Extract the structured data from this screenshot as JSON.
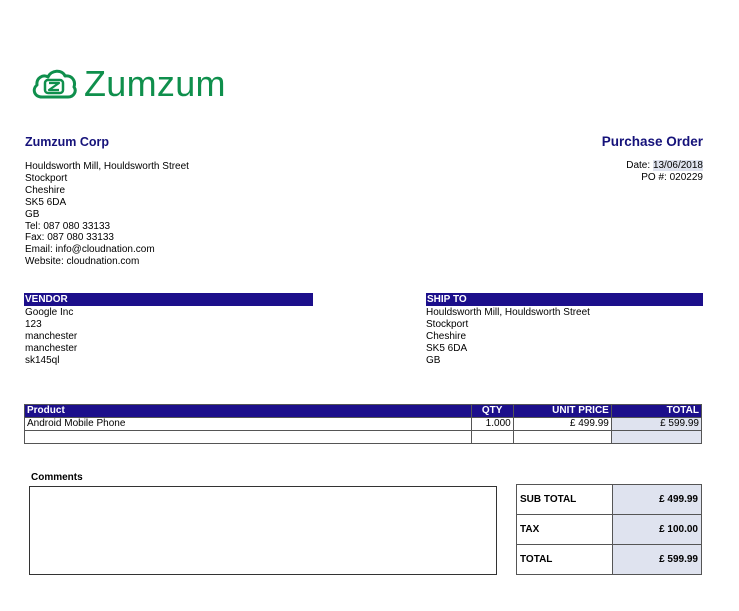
{
  "brand": {
    "name": "Zumzum",
    "logo_icon": "cloud-z-logo-icon",
    "color": "#0f8f4c"
  },
  "company": {
    "name": "Zumzum Corp",
    "address_lines": [
      "Houldsworth Mill, Houldsworth Street",
      "Stockport",
      "Cheshire",
      "SK5 6DA",
      "GB",
      "Tel: 087 080 33133",
      "Fax: 087 080 33133",
      "Email: info@cloudnation.com",
      "Website: cloudnation.com"
    ]
  },
  "document": {
    "title": "Purchase Order",
    "date_label": "Date: ",
    "date_value": "13/06/2018",
    "po_label": "PO #: ",
    "po_value": "020229"
  },
  "vendor": {
    "heading": "VENDOR",
    "lines": [
      "Google Inc",
      "123",
      "manchester",
      "manchester",
      "sk145ql"
    ]
  },
  "ship_to": {
    "heading": "SHIP TO",
    "lines": [
      "Houldsworth Mill, Houldsworth Street",
      "Stockport",
      "Cheshire",
      "SK5 6DA",
      "GB"
    ]
  },
  "items_table": {
    "headers": {
      "product": "Product",
      "qty": "QTY",
      "unit_price": "UNIT PRICE",
      "total": "TOTAL"
    },
    "rows": [
      {
        "product": "Android Mobile Phone",
        "qty": "1.000",
        "unit_price": "£ 499.99",
        "total": "£ 599.99"
      }
    ]
  },
  "comments": {
    "label": "Comments",
    "value": ""
  },
  "totals": {
    "sub_total_label": "SUB TOTAL",
    "sub_total_value": "£ 499.99",
    "tax_label": "TAX",
    "tax_value": "£ 100.00",
    "total_label": "TOTAL",
    "total_value": "£ 599.99"
  },
  "colors": {
    "header_bg": "#1c0f8b",
    "heading_text": "#15127a",
    "shade": "#dfe3ef"
  }
}
